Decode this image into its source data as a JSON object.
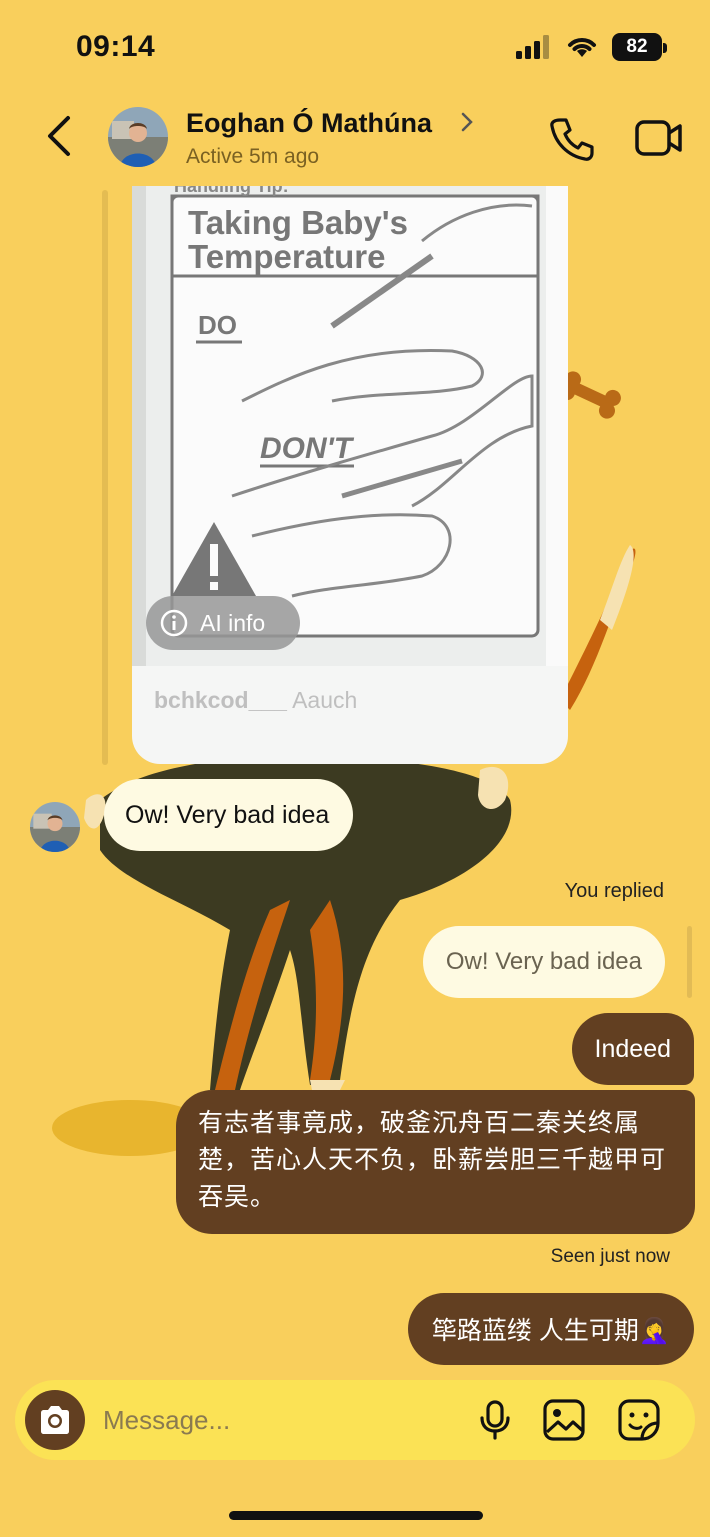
{
  "status_bar": {
    "time": "09:14",
    "battery": "82"
  },
  "header": {
    "contact_name": "Eoghan Ó Mathúna",
    "active_status": "Active 5m ago"
  },
  "shared_post": {
    "image_heading": "Taking Baby's Temperature",
    "image_label_do": "DO",
    "image_label_dont": "DON'T",
    "image_tag": "Handling Tip:",
    "ai_info_label": "AI info",
    "caption_user": "bchkcod___",
    "caption_text": "Aauch"
  },
  "messages": {
    "incoming_1": "Ow! Very bad idea",
    "you_replied_label": "You replied",
    "quoted_reply": "Ow! Very bad idea",
    "outgoing_1": "Indeed",
    "outgoing_2": "有志者事竟成，破釜沉舟百二秦关终属楚，苦心人天不负，卧薪尝胆三千越甲可吞吴。",
    "seen_label": "Seen just now",
    "outgoing_3": "筚路蓝缕 人生可期🤦‍♀️"
  },
  "composer": {
    "placeholder": "Message..."
  },
  "colors": {
    "background": "#F9CF5C",
    "outgoing_bubble": "#623F21",
    "incoming_bubble": "#FEFAE2",
    "composer": "#FBE255"
  },
  "icons": [
    "back-icon",
    "chevron-right-icon",
    "phone-icon",
    "video-camera-icon",
    "info-icon",
    "camera-icon",
    "microphone-icon",
    "gallery-icon",
    "sticker-icon"
  ]
}
